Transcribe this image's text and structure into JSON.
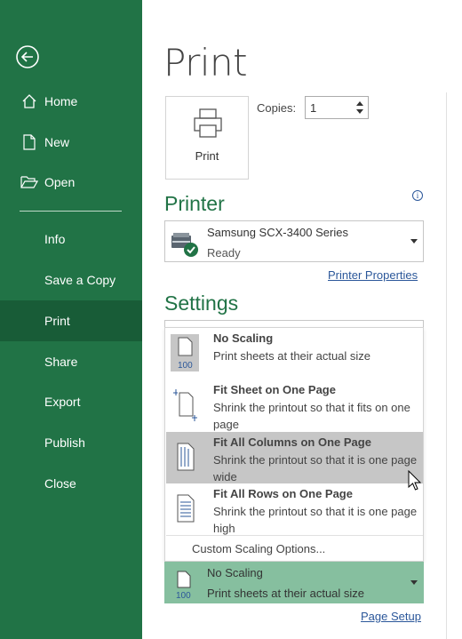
{
  "sidebar": {
    "items": [
      {
        "label": "Home"
      },
      {
        "label": "New"
      },
      {
        "label": "Open"
      },
      {
        "label": "Info"
      },
      {
        "label": "Save a Copy"
      },
      {
        "label": "Print"
      },
      {
        "label": "Share"
      },
      {
        "label": "Export"
      },
      {
        "label": "Publish"
      },
      {
        "label": "Close"
      }
    ]
  },
  "main": {
    "title": "Print",
    "print_button": "Print",
    "copies_label": "Copies:",
    "copies_value": "1",
    "printer_heading": "Printer",
    "printer_name": "Samsung SCX-3400 Series",
    "printer_status": "Ready",
    "printer_properties": "Printer Properties",
    "settings_heading": "Settings",
    "page_setup": "Page Setup"
  },
  "scaling_menu": {
    "options": [
      {
        "title": "No Scaling",
        "desc": "Print sheets at their actual size",
        "icon_text": "100"
      },
      {
        "title": "Fit Sheet on One Page",
        "desc": "Shrink the printout so that it fits on one page"
      },
      {
        "title": "Fit All Columns on One Page",
        "desc": "Shrink the printout so that it is one page wide"
      },
      {
        "title": "Fit All Rows on One Page",
        "desc": "Shrink the printout so that it is one page high"
      }
    ],
    "custom": "Custom Scaling Options..."
  },
  "scaling_selected": {
    "title": "No Scaling",
    "desc": "Print sheets at their actual size",
    "icon_text": "100"
  },
  "colors": {
    "sidebar": "#217346",
    "sidebar_active": "#185c37",
    "accent": "#217346",
    "link": "#2b579a",
    "hover": "#c6c6c6",
    "selected": "#86bf9f"
  }
}
